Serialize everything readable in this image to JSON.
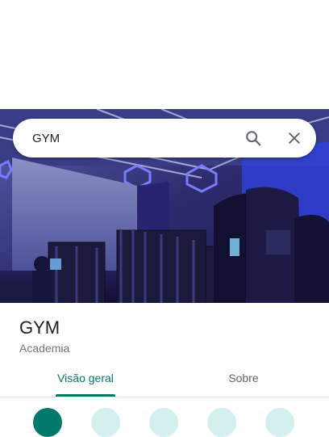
{
  "search": {
    "value": "GYM",
    "placeholder": ""
  },
  "icons": {
    "search": "search-icon",
    "close": "close-icon"
  },
  "place": {
    "name": "GYM",
    "category": "Academia"
  },
  "tabs": [
    {
      "label": "Visão geral",
      "active": true
    },
    {
      "label": "Sobre",
      "active": false
    }
  ],
  "colors": {
    "accent": "#00796b",
    "hero_blue": "#3d3fa8"
  }
}
